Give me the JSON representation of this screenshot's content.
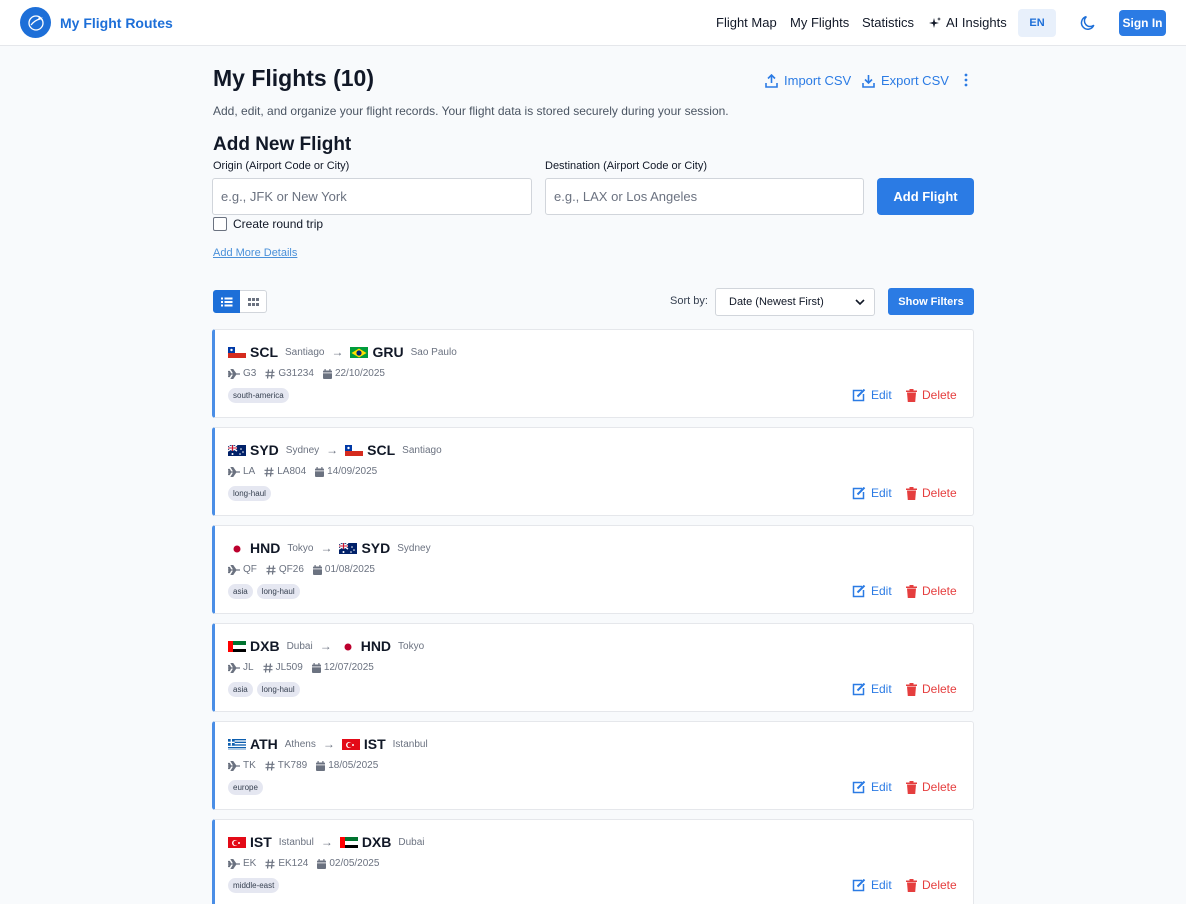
{
  "app": {
    "title": "My Flight Routes"
  },
  "nav": {
    "flight_map": "Flight Map",
    "my_flights": "My Flights",
    "statistics": "Statistics",
    "ai_insights": "AI Insights",
    "language": "EN",
    "sign_in": "Sign In"
  },
  "page": {
    "title": "My Flights (10)",
    "subtitle": "Add, edit, and organize your flight records. Your flight data is stored securely during your session.",
    "import_csv": "Import CSV",
    "export_csv": "Export CSV"
  },
  "form": {
    "title": "Add New Flight",
    "origin_label": "Origin (Airport Code or City)",
    "origin_placeholder": "e.g., JFK or New York",
    "destination_label": "Destination (Airport Code or City)",
    "destination_placeholder": "e.g., LAX or Los Angeles",
    "add_button": "Add Flight",
    "round_trip_label": "Create round trip",
    "more_details": "Add More Details"
  },
  "controls": {
    "sort_label": "Sort by:",
    "sort_value": "Date (Newest First)",
    "show_filters": "Show Filters"
  },
  "actions": {
    "edit": "Edit",
    "delete": "Delete"
  },
  "flights": [
    {
      "from_flag": "CL",
      "from_code": "SCL",
      "from_city": "Santiago",
      "to_flag": "BR",
      "to_code": "GRU",
      "to_city": "Sao Paulo",
      "airline": "G3",
      "flight_no": "G31234",
      "date": "22/10/2025",
      "tags": [
        "south-america"
      ]
    },
    {
      "from_flag": "AU",
      "from_code": "SYD",
      "from_city": "Sydney",
      "to_flag": "CL",
      "to_code": "SCL",
      "to_city": "Santiago",
      "airline": "LA",
      "flight_no": "LA804",
      "date": "14/09/2025",
      "tags": [
        "long-haul"
      ]
    },
    {
      "from_flag": "JP",
      "from_code": "HND",
      "from_city": "Tokyo",
      "to_flag": "AU",
      "to_code": "SYD",
      "to_city": "Sydney",
      "airline": "QF",
      "flight_no": "QF26",
      "date": "01/08/2025",
      "tags": [
        "asia",
        "long-haul"
      ]
    },
    {
      "from_flag": "AE",
      "from_code": "DXB",
      "from_city": "Dubai",
      "to_flag": "JP",
      "to_code": "HND",
      "to_city": "Tokyo",
      "airline": "JL",
      "flight_no": "JL509",
      "date": "12/07/2025",
      "tags": [
        "asia",
        "long-haul"
      ]
    },
    {
      "from_flag": "GR",
      "from_code": "ATH",
      "from_city": "Athens",
      "to_flag": "TR",
      "to_code": "IST",
      "to_city": "Istanbul",
      "airline": "TK",
      "flight_no": "TK789",
      "date": "18/05/2025",
      "tags": [
        "europe"
      ]
    },
    {
      "from_flag": "TR",
      "from_code": "IST",
      "from_city": "Istanbul",
      "to_flag": "AE",
      "to_code": "DXB",
      "to_city": "Dubai",
      "airline": "EK",
      "flight_no": "EK124",
      "date": "02/05/2025",
      "tags": [
        "middle-east"
      ]
    }
  ],
  "colors": {
    "accent": "#2b7be4",
    "brand": "#1d6fd8",
    "danger": "#e53e3e",
    "card_border": "#4a8ee6"
  }
}
